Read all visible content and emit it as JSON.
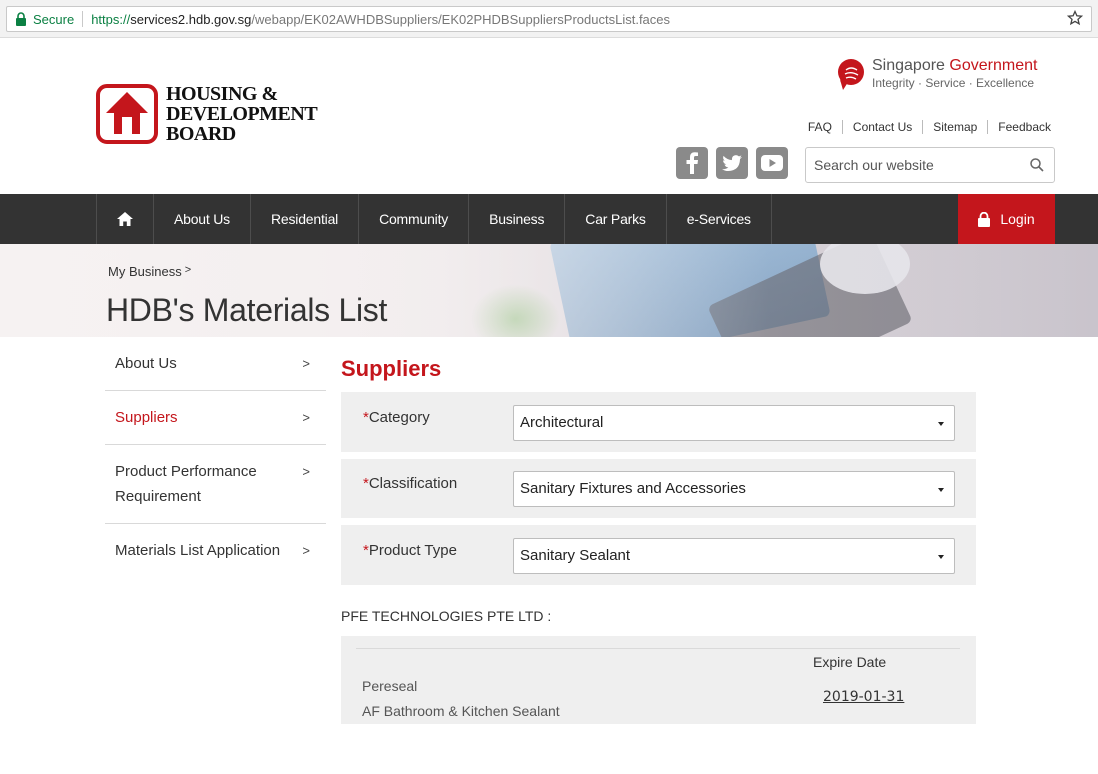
{
  "browser": {
    "secure_label": "Secure",
    "url_scheme": "https://",
    "url_host": "services2.hdb.gov.sg",
    "url_path": "/webapp/EK02AWHDBSuppliers/EK02PHDBSuppliersProductsList.faces"
  },
  "header": {
    "logo_line1": "HOUSING &",
    "logo_line2": "DEVELOPMENT",
    "logo_line3": "BOARD",
    "sg_word1": "Singapore",
    "sg_word2": "Government",
    "sg_tagline": "Integrity · Service · Excellence",
    "links": [
      "FAQ",
      "Contact Us",
      "Sitemap",
      "Feedback"
    ],
    "search_placeholder": "Search our website"
  },
  "nav": {
    "items": [
      "About Us",
      "Residential",
      "Community",
      "Business",
      "Car Parks",
      "e-Services"
    ],
    "login_label": "Login"
  },
  "banner": {
    "breadcrumb": "My Business",
    "breadcrumb_sep": ">",
    "title": "HDB's Materials List"
  },
  "sidebar": {
    "items": [
      {
        "label": "About Us"
      },
      {
        "label": "Suppliers"
      },
      {
        "label": "Product Performance Requirement"
      },
      {
        "label": "Materials List Application"
      }
    ]
  },
  "main": {
    "title": "Suppliers",
    "required_mark": "*",
    "filters": [
      {
        "label": "Category",
        "value": "Architectural"
      },
      {
        "label": "Classification",
        "value": "Sanitary Fixtures and Accessories"
      },
      {
        "label": "Product Type",
        "value": "Sanitary Sealant"
      }
    ],
    "company": "PFE TECHNOLOGIES PTE LTD :",
    "table": {
      "expire_header": "Expire Date",
      "rows": [
        {
          "brand": "Pereseal",
          "name": "AF Bathroom & Kitchen Sealant",
          "expire": "2019-01-31"
        }
      ]
    }
  },
  "colors": {
    "brand_red": "#c4161c",
    "nav_bg": "#333333",
    "secure_green": "#0b8043"
  }
}
